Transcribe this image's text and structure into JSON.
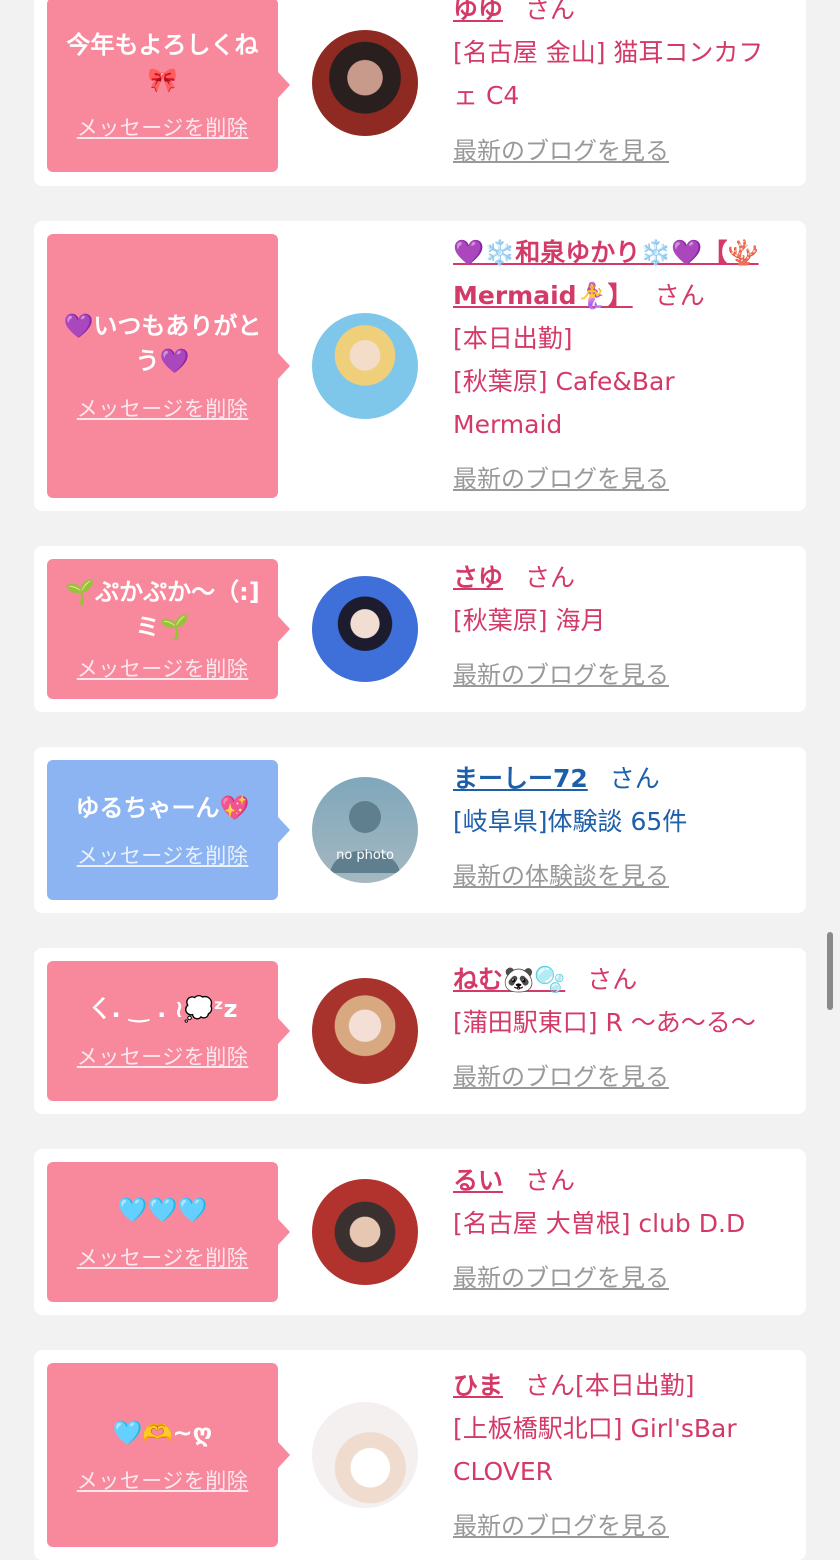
{
  "delete_label": "メッセージを削除",
  "san": "さん",
  "entries": [
    {
      "message": "今年もよろしくね🎀",
      "name": "ゆゆ",
      "lines": [
        "[名古屋 金山] 猫耳コンカフェ C4"
      ],
      "link": "最新のブログを見る"
    },
    {
      "message": "💜いつもありがとう💜",
      "name": "💜❄️和泉ゆかり❄️💜【🪸Mermaid🧜‍♀️】",
      "lines": [
        "[本日出勤]",
        "[秋葉原] Cafe&Bar Mermaid"
      ],
      "link": "最新のブログを見る"
    },
    {
      "message": "🌱ぷかぷか〜（:] ミ🌱",
      "name": "さゆ",
      "lines": [
        "[秋葉原] 海月"
      ],
      "link": "最新のブログを見る"
    },
    {
      "message": "ゆるちゃーん💖",
      "name": "まーしー72",
      "lines": [
        "[岐阜県]体験談 65件"
      ],
      "link": "最新の体験談を見る",
      "avatar_text": "no photo"
    },
    {
      "message": "ㄑ. ‿ . ≀💭ᶻz",
      "name": "ねむ🐼🫧",
      "lines": [
        "[蒲田駅東口] R 〜あ〜る〜"
      ],
      "link": "最新のブログを見る"
    },
    {
      "message": "🩵🩵🩵",
      "name": "るい",
      "lines": [
        "[名古屋 大曽根] club D.D"
      ],
      "link": "最新のブログを見る"
    },
    {
      "message": "🩵🫶~ღ",
      "name": "ひま",
      "name_suffix": "[本日出勤]",
      "lines": [
        "[上板橋駅北口] Girl'sBar CLOVER"
      ],
      "link": "最新のブログを見る"
    }
  ],
  "colors": {
    "pink": "#f8889c",
    "blue": "#8cb4f2",
    "accent": "#d43a68",
    "link_blue": "#1d5fa8"
  }
}
